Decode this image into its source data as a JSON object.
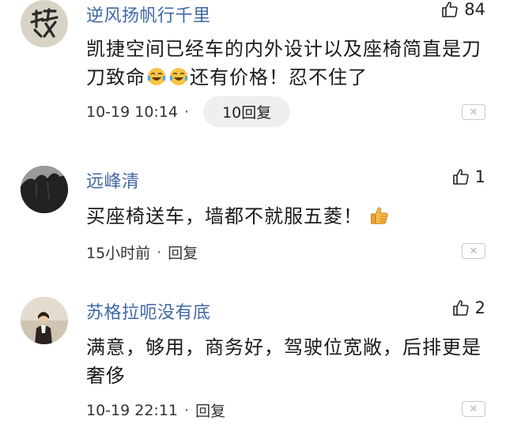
{
  "comments": [
    {
      "username": "逆风扬帆行千里",
      "likes": "84",
      "text_before_emoji": "凯捷空间已经车的内外设计以及座椅简直是刀刀致命",
      "text_after_emoji": "还有价格！忍不住了",
      "time": "10-19 10:14",
      "separator": "·",
      "reply": "10回复",
      "close_glyph": "✕"
    },
    {
      "username": "远峰清",
      "likes": "1",
      "text": "买座椅送车，墙都不就服五菱！",
      "time": "15小时前",
      "separator": "·",
      "reply": "回复",
      "close_glyph": "✕"
    },
    {
      "username": "苏格拉呃没有底",
      "likes": "2",
      "text": "满意，够用，商务好，驾驶位宽敞，后排更是奢侈",
      "time": "10-19 22:11",
      "separator": "·",
      "reply": "回复",
      "close_glyph": "✕"
    }
  ],
  "icons": {
    "like": "thumbs-up-outline-icon",
    "crying_laughing": "face-with-tears-of-joy-icon",
    "thumbs_up_emoji": "thumbs-up-emoji-icon",
    "close": "close-icon"
  },
  "colors": {
    "username": "#3f67a4",
    "reply_pill_bg": "#efefef",
    "close_border": "#c8c8c8"
  }
}
